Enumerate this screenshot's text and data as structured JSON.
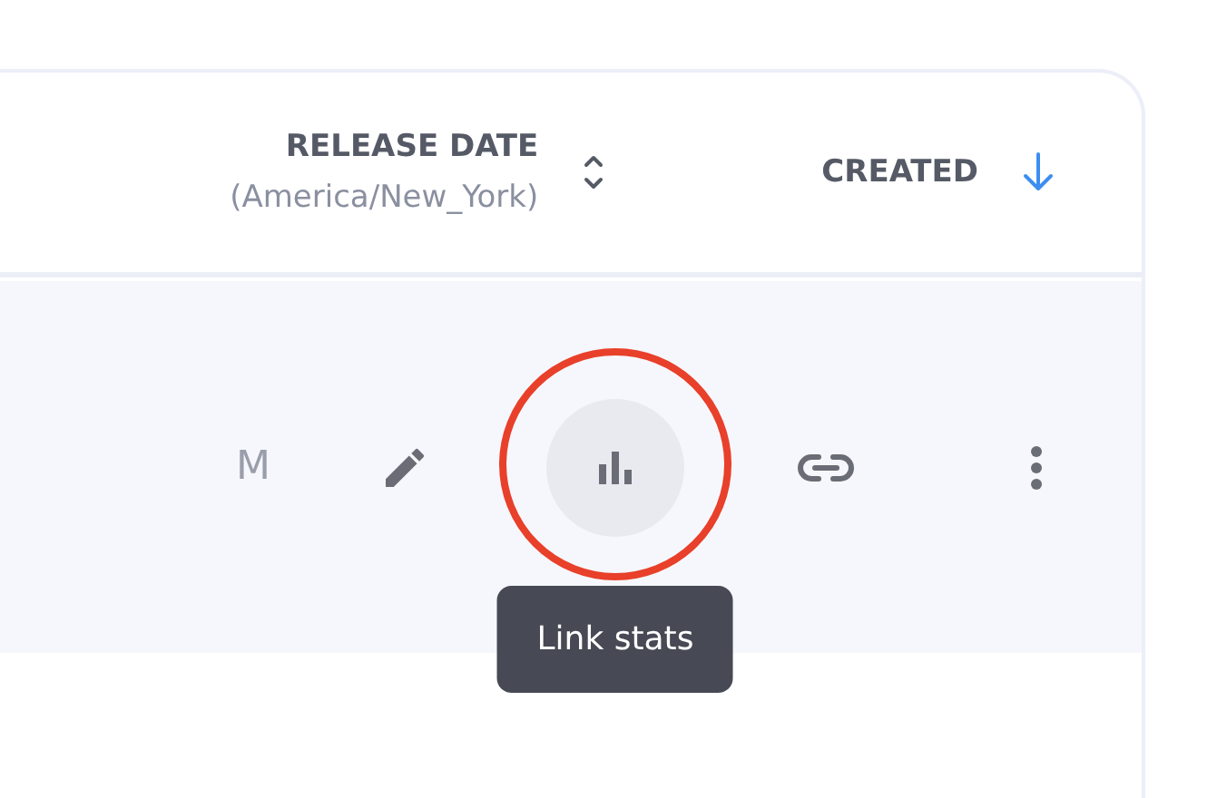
{
  "table": {
    "columns": [
      {
        "title": "RELEASE DATE",
        "subtitle": "(America/New_York)",
        "sorted": false
      },
      {
        "title": "CREATED",
        "sorted": true
      }
    ],
    "rows": [
      {
        "cell_text": "M",
        "actions": [
          {
            "kind": "edit",
            "highlighted": false
          },
          {
            "kind": "stats",
            "highlighted": true,
            "tooltip": "Link stats"
          },
          {
            "kind": "link",
            "highlighted": false
          },
          {
            "kind": "more",
            "highlighted": false
          }
        ]
      }
    ]
  }
}
